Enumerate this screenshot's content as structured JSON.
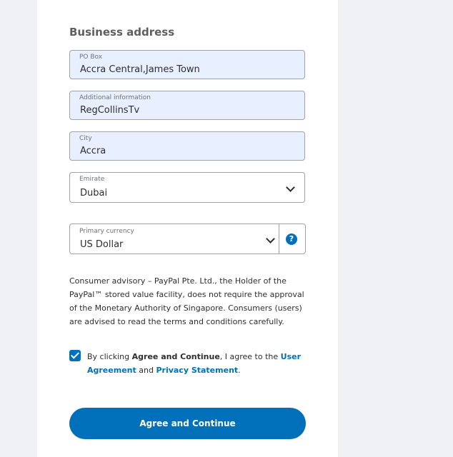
{
  "section": {
    "title": "Business address"
  },
  "fields": {
    "po_box": {
      "label": "PO Box",
      "value": "Accra Central,James Town"
    },
    "additional": {
      "label": "Additional information",
      "value": "RegCollinsTv"
    },
    "city": {
      "label": "City",
      "value": "Accra"
    },
    "emirate": {
      "label": "Emirate",
      "value": "Dubai"
    },
    "currency": {
      "label": "Primary currency",
      "value": "US Dollar"
    }
  },
  "help": {
    "glyph": "?"
  },
  "advisory": "Consumer advisory – PayPal Pte. Ltd., the Holder of the PayPal™ stored value facility, does not require the approval of the Monetary Authority of Singapore. Consumers (users) are advised to read the terms and conditions carefully.",
  "consent": {
    "checked": true,
    "prefix": "By clicking ",
    "emphasis": "Agree and Continue",
    "middle": ", I agree to the ",
    "user_agreement": "User Agreement",
    "and": " and ",
    "privacy": "Privacy Statement",
    "suffix": "."
  },
  "cta": {
    "label": "Agree and Continue"
  },
  "colors": {
    "accent": "#0070ba",
    "filled_field": "#e8efff",
    "background": "#f0f1f5"
  }
}
